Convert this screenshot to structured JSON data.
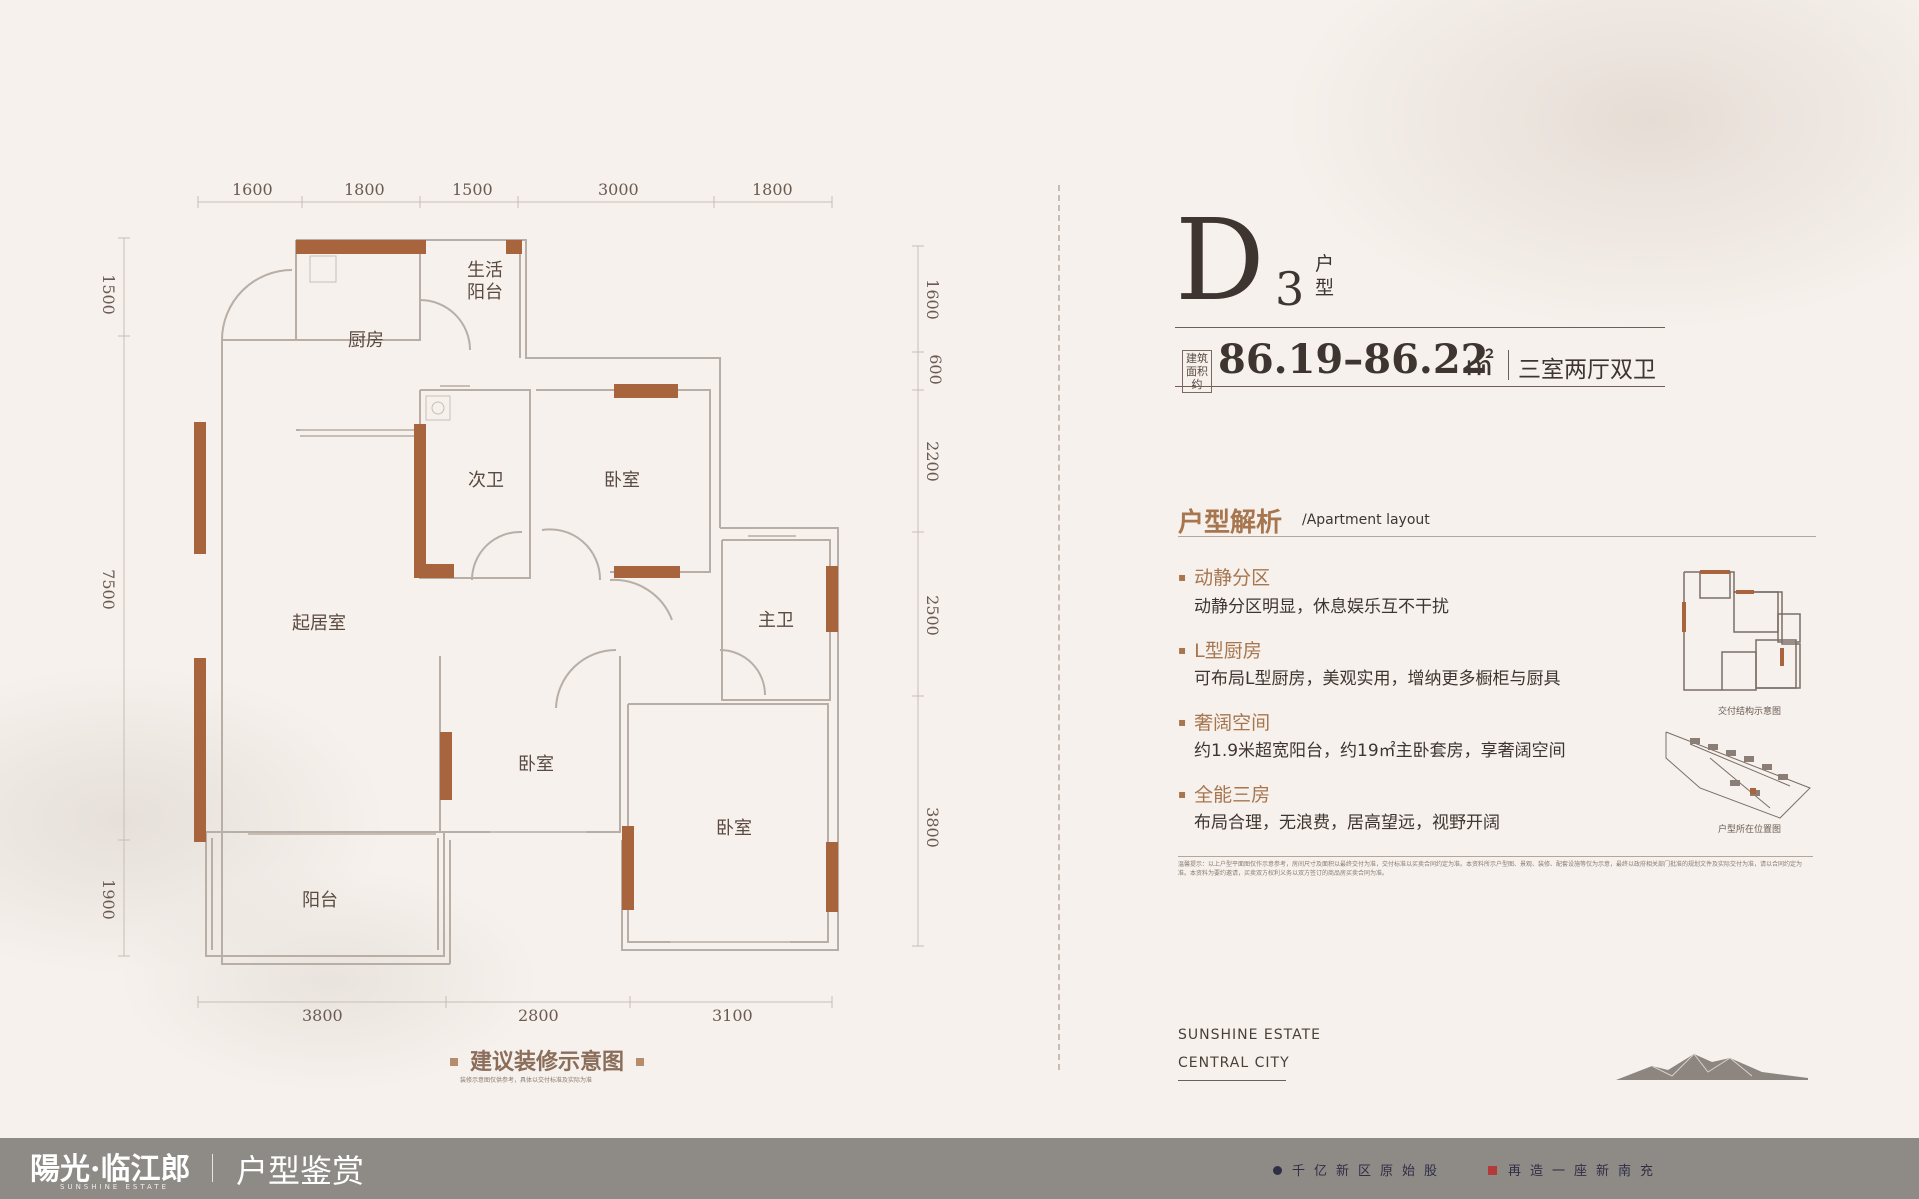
{
  "plan": {
    "dims_top": [
      "1600",
      "1800",
      "1500",
      "3000",
      "1800"
    ],
    "dims_bottom": [
      "3800",
      "2800",
      "3100"
    ],
    "dims_left": [
      "1500",
      "7500",
      "1900"
    ],
    "dims_right": [
      "1600",
      "600",
      "2200",
      "2500",
      "3800"
    ],
    "rooms": {
      "kitchen": "厨房",
      "utility_balcony": "生活\n阳台",
      "second_bath": "次卫",
      "bedroom_a": "卧室",
      "living": "起居室",
      "master_bath": "主卫",
      "bedroom_b": "卧室",
      "bedroom_c": "卧室",
      "balcony": "阳台"
    },
    "title": "建议装修示意图",
    "note": "装修示意图仅供参考，具体以交付标准及实际为准"
  },
  "unit": {
    "letter": "D",
    "number": "3",
    "huxing": "户型",
    "area_tag": "建筑面积约",
    "area": "86.19–86.22",
    "area_unit": "㎡",
    "rooms": "三室两厅双卫"
  },
  "analysis": {
    "title": "户型解析",
    "subtitle": "/Apartment layout",
    "features": [
      {
        "title": "动静分区",
        "desc": "动静分区明显，休息娱乐互不干扰"
      },
      {
        "title": "L型厨房",
        "desc": "可布局L型厨房，美观实用，增纳更多橱柜与厨具"
      },
      {
        "title": "奢阔空间",
        "desc": "约1.9米超宽阳台，约19㎡主卧套房，享奢阔空间"
      },
      {
        "title": "全能三房",
        "desc": "布局合理，无浪费，居高望远，视野开阔"
      }
    ],
    "thumb1_caption": "交付结构示意图",
    "thumb2_caption": "户型所在位置图",
    "disclaimer": "温馨提示：以上户型平面图仅作示意参考，房间尺寸及面积以最终交付为准，交付标准以买卖合同约定为准。本资料所示户型图、景观、装修、配套设施等仅为示意，最终以政府相关部门批准的规划文件及实际交付为准，请以合同约定为准。本资料为要约邀请，买卖双方权利义务以双方签订的商品房买卖合同为准。"
  },
  "brand": {
    "en_line1": "SUNSHINE ESTATE",
    "en_line2": "CENTRAL CITY"
  },
  "footer": {
    "logo": "陽光·临江郎",
    "logo_en": "SUNSHINE ESTATE",
    "section": "户型鉴赏",
    "slogan1": "千亿新区原始股",
    "slogan2": "再造一座新南充"
  },
  "colors": {
    "accent": "#a7764f",
    "wall_highlight": "#a8643c",
    "bar": "#8e8a86",
    "text": "#3f3530"
  }
}
